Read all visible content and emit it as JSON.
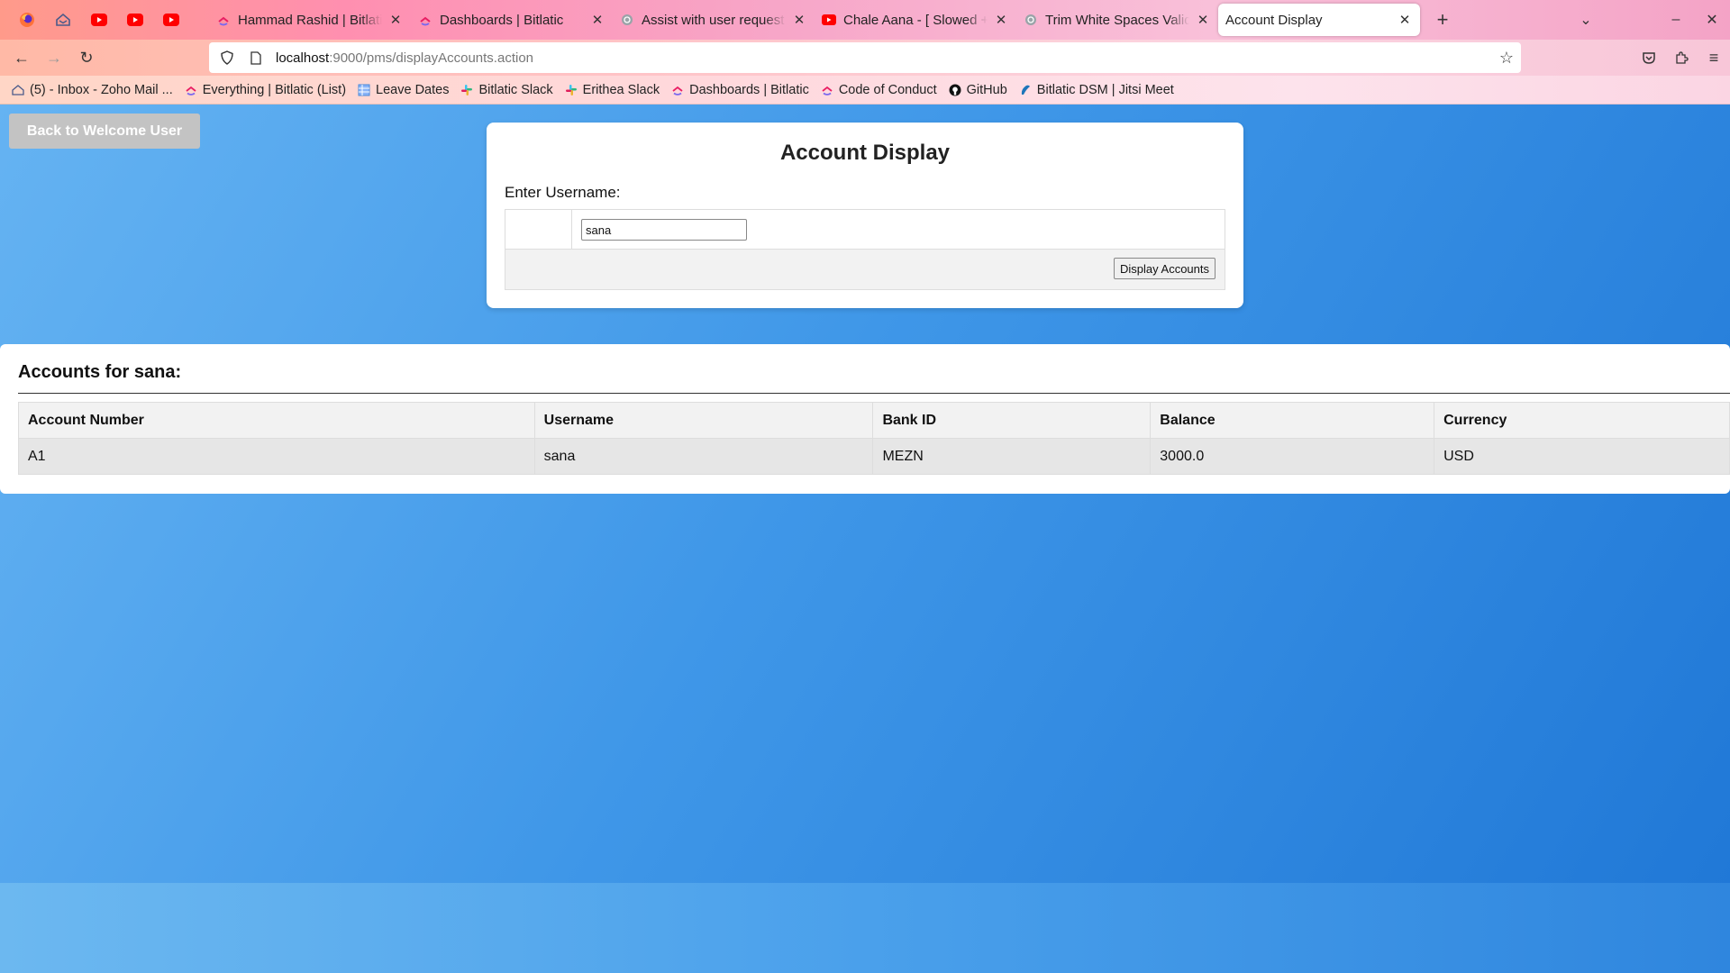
{
  "browser": {
    "pinned_tabs": [
      {
        "icon": "firefox-icon"
      },
      {
        "icon": "zoho-mail-icon"
      },
      {
        "icon": "youtube-icon"
      },
      {
        "icon": "youtube-icon"
      },
      {
        "icon": "youtube-icon"
      }
    ],
    "tabs": [
      {
        "label": "Hammad Rashid | Bitlatic",
        "icon": "clickup-icon",
        "active": false
      },
      {
        "label": "Dashboards | Bitlatic",
        "icon": "clickup-icon",
        "active": false
      },
      {
        "label": "Assist with user request",
        "icon": "chatgpt-icon",
        "active": false
      },
      {
        "label": "Chale Aana - [ Slowed + R",
        "icon": "youtube-icon",
        "active": false
      },
      {
        "label": "Trim White Spaces Valida",
        "icon": "chatgpt-icon",
        "active": false
      },
      {
        "label": "Account Display",
        "icon": "",
        "active": true
      }
    ],
    "url_host": "localhost",
    "url_path": ":9000/pms/displayAccounts.action",
    "bookmarks": [
      {
        "label": "(5) - Inbox - Zoho Mail ...",
        "icon": "zoho-mail-icon"
      },
      {
        "label": "Everything | Bitlatic (List)",
        "icon": "clickup-icon"
      },
      {
        "label": "Leave Dates",
        "icon": "sheet-icon"
      },
      {
        "label": "Bitlatic Slack",
        "icon": "slack-icon"
      },
      {
        "label": "Erithea Slack",
        "icon": "slack-icon"
      },
      {
        "label": "Dashboards | Bitlatic",
        "icon": "clickup-icon"
      },
      {
        "label": "Code of Conduct",
        "icon": "clickup-icon"
      },
      {
        "label": "GitHub",
        "icon": "github-icon"
      },
      {
        "label": "Bitlatic DSM | Jitsi Meet",
        "icon": "jitsi-icon"
      }
    ]
  },
  "page": {
    "back_button": "Back to Welcome User",
    "card_title": "Account Display",
    "username_label": "Enter Username:",
    "username_value": "sana",
    "submit_label": "Display Accounts",
    "results_heading": "Accounts for sana:",
    "columns": [
      "Account Number",
      "Username",
      "Bank ID",
      "Balance",
      "Currency"
    ],
    "rows": [
      [
        "A1",
        "sana",
        "MEZN",
        "3000.0",
        "USD"
      ]
    ]
  },
  "colors": {
    "page_gradient_start": "#65b3f2",
    "page_gradient_end": "#1f77d6",
    "back_button_bg": "#c3c3c3"
  }
}
